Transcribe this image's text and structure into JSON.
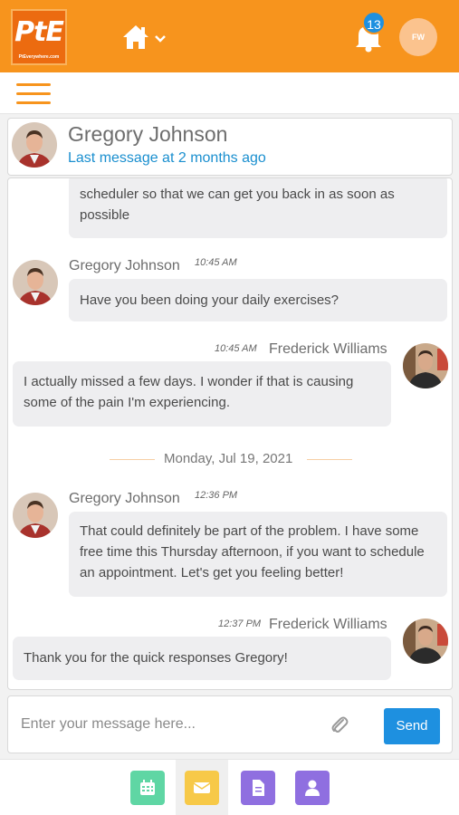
{
  "header": {
    "logo_text": "PtE",
    "logo_subtext": "PtEverywhere.com",
    "notification_count": "13",
    "user_initials": "FW"
  },
  "chat": {
    "contact_name": "Gregory Johnson",
    "last_message": "Last message at 2 months ago"
  },
  "messages": {
    "m0": {
      "text": "scheduler so that we can get you back in as soon as possible"
    },
    "m1": {
      "sender": "Gregory Johnson",
      "time": "10:45 AM",
      "text": "Have you been doing your daily exercises?"
    },
    "m2": {
      "sender": "Frederick Williams",
      "time": "10:45 AM",
      "text": "I actually missed a few days. I wonder if that is causing some of the pain I'm experiencing."
    },
    "date_divider": "Monday, Jul 19, 2021",
    "m3": {
      "sender": "Gregory Johnson",
      "time": "12:36 PM",
      "text": "That could definitely be part of the problem. I have some free time this Thursday afternoon, if you want to schedule an appointment. Let's get you feeling better!"
    },
    "m4": {
      "sender": "Frederick Williams",
      "time": "12:37 PM",
      "text": "Thank you for the quick responses Gregory!"
    }
  },
  "composer": {
    "placeholder": "Enter your message here...",
    "send_label": "Send"
  },
  "bottom_nav": {
    "items": [
      {
        "icon": "calendar-icon",
        "color": "#5fd6a4"
      },
      {
        "icon": "envelope-icon",
        "color": "#f7c948",
        "selected": true
      },
      {
        "icon": "document-icon",
        "color": "#8f6fe0"
      },
      {
        "icon": "user-icon",
        "color": "#8f6fe0"
      }
    ]
  },
  "colors": {
    "brand_orange": "#f7941d",
    "accent_blue": "#1e90e0",
    "bubble_gray": "#eeeef0"
  }
}
